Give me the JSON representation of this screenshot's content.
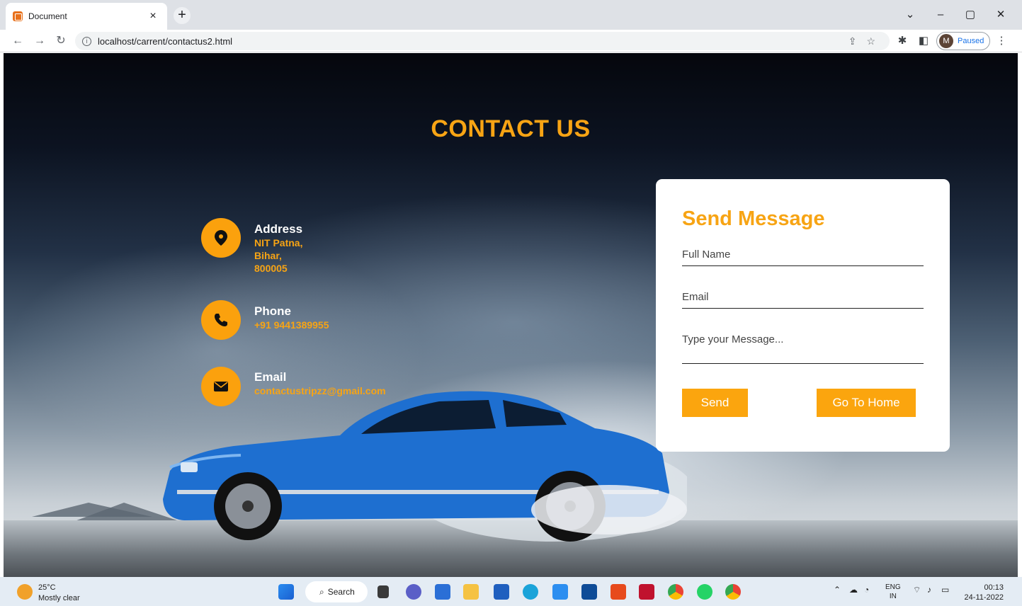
{
  "browser": {
    "tab_title": "Document",
    "tab_close": "×",
    "new_tab": "+",
    "url": "localhost/carrent/contactus2.html",
    "profile_initial": "M",
    "profile_status": "Paused",
    "window_controls": [
      "chevron-down-icon",
      "minimize-icon",
      "restore-icon",
      "close-icon"
    ]
  },
  "page": {
    "heading": "CONTACT US",
    "contact": {
      "address": {
        "label": "Address",
        "lines": [
          "NIT Patna,",
          "Bihar,",
          "800005"
        ]
      },
      "phone": {
        "label": "Phone",
        "value": "+91 9441389955"
      },
      "email": {
        "label": "Email",
        "value": "contactustripzz@gmail.com"
      }
    },
    "form": {
      "title": "Send Message",
      "full_name_placeholder": "Full Name",
      "email_placeholder": "Email",
      "message_placeholder": "Type your Message...",
      "send_label": "Send",
      "home_label": "Go To Home"
    }
  },
  "taskbar": {
    "temperature": "25°C",
    "weather": "Mostly clear",
    "search_label": "Search",
    "language": "ENG",
    "region": "IN",
    "time": "00:13",
    "date": "24-11-2022"
  },
  "colors": {
    "accent": "#f7a414",
    "button": "#fba50e",
    "card": "#ffffff"
  }
}
